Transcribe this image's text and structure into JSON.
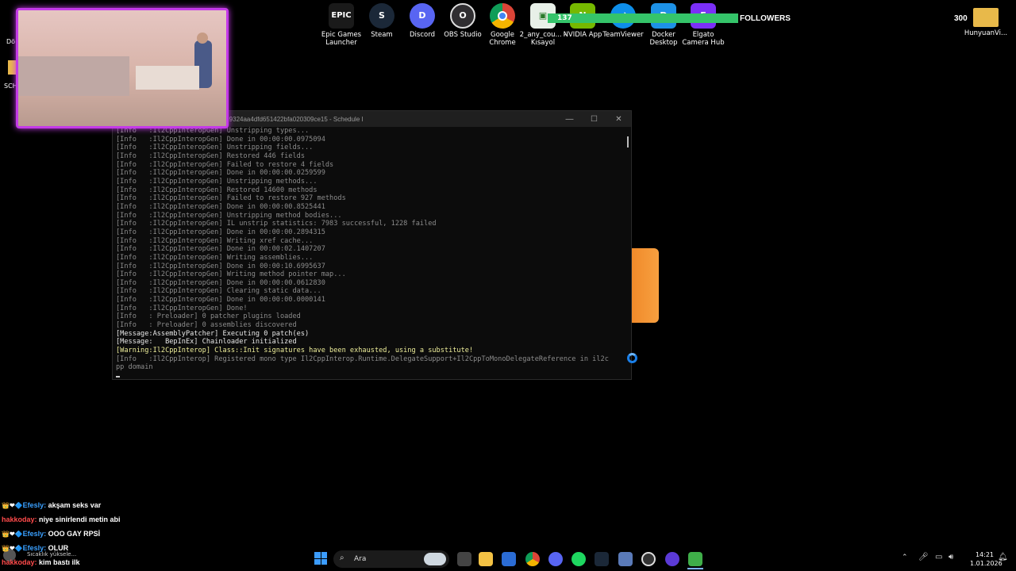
{
  "desktop_icons": [
    {
      "label": "Epic Games Launcher",
      "icon": "epic-games-icon",
      "color": "#1a1a1a",
      "glyph": "EPIC"
    },
    {
      "label": "Steam",
      "icon": "steam-icon",
      "color": "#1b2838",
      "glyph": "S"
    },
    {
      "label": "Discord",
      "icon": "discord-icon",
      "color": "#5865f2",
      "glyph": "D"
    },
    {
      "label": "OBS Studio",
      "icon": "obs-icon",
      "color": "#302e31",
      "glyph": "O"
    },
    {
      "label": "Google Chrome",
      "icon": "chrome-icon",
      "color": "#db4437",
      "glyph": "◉"
    },
    {
      "label": "2_any_cou... - Kısayol",
      "icon": "shortcut-icon",
      "color": "#e8f0e8",
      "glyph": "▣"
    },
    {
      "label": "NVIDIA App",
      "icon": "nvidia-icon",
      "color": "#76b900",
      "glyph": "N"
    },
    {
      "label": "TeamViewer",
      "icon": "teamviewer-icon",
      "color": "#0e8ee9",
      "glyph": "⇄"
    },
    {
      "label": "Docker Desktop",
      "icon": "docker-icon",
      "color": "#1d91e6",
      "glyph": "D"
    },
    {
      "label": "Elgato Camera Hub",
      "icon": "elgato-icon",
      "color": "#7b2ff7",
      "glyph": "E"
    },
    {
      "label": "HunyuanVi...",
      "icon": "folder-icon",
      "color": "#e8b94a",
      "glyph": ""
    }
  ],
  "left_icons": {
    "top_label": "Dö",
    "bottom_label": "SCH"
  },
  "followers": {
    "count": "137",
    "label": "FOLLOWERS",
    "goal": "300",
    "progress": 0.457
  },
  "console": {
    "title": "...9324aa4dfd651422bfa020309ce15 - Schedule I",
    "lines": [
      {
        "type": "info",
        "text": "[Info   :Il2CppInteropGen] Unstripping types..."
      },
      {
        "type": "info",
        "text": "[Info   :Il2CppInteropGen] Done in 00:00:00.0975094"
      },
      {
        "type": "info",
        "text": "[Info   :Il2CppInteropGen] Unstripping fields..."
      },
      {
        "type": "info",
        "text": "[Info   :Il2CppInteropGen] Restored 446 fields"
      },
      {
        "type": "info",
        "text": "[Info   :Il2CppInteropGen] Failed to restore 4 fields"
      },
      {
        "type": "info",
        "text": "[Info   :Il2CppInteropGen] Done in 00:00:00.0259599"
      },
      {
        "type": "info",
        "text": "[Info   :Il2CppInteropGen] Unstripping methods..."
      },
      {
        "type": "info",
        "text": "[Info   :Il2CppInteropGen] Restored 14600 methods"
      },
      {
        "type": "info",
        "text": "[Info   :Il2CppInteropGen] Failed to restore 927 methods"
      },
      {
        "type": "info",
        "text": "[Info   :Il2CppInteropGen] Done in 00:00:00.8525441"
      },
      {
        "type": "info",
        "text": "[Info   :Il2CppInteropGen] Unstripping method bodies..."
      },
      {
        "type": "info",
        "text": "[Info   :Il2CppInteropGen] IL unstrip statistics: 7983 successful, 1228 failed"
      },
      {
        "type": "info",
        "text": "[Info   :Il2CppInteropGen] Done in 00:00:00.2894315"
      },
      {
        "type": "info",
        "text": "[Info   :Il2CppInteropGen] Writing xref cache..."
      },
      {
        "type": "info",
        "text": "[Info   :Il2CppInteropGen] Done in 00:00:02.1407207"
      },
      {
        "type": "info",
        "text": "[Info   :Il2CppInteropGen] Writing assemblies..."
      },
      {
        "type": "info",
        "text": "[Info   :Il2CppInteropGen] Done in 00:00:10.6995637"
      },
      {
        "type": "info",
        "text": "[Info   :Il2CppInteropGen] Writing method pointer map..."
      },
      {
        "type": "info",
        "text": "[Info   :Il2CppInteropGen] Done in 00:00:00.0612830"
      },
      {
        "type": "info",
        "text": "[Info   :Il2CppInteropGen] Clearing static data..."
      },
      {
        "type": "info",
        "text": "[Info   :Il2CppInteropGen] Done in 00:00:00.0000141"
      },
      {
        "type": "info",
        "text": "[Info   :Il2CppInteropGen] Done!"
      },
      {
        "type": "info",
        "text": "[Info   : Preloader] 0 patcher plugins loaded"
      },
      {
        "type": "info",
        "text": "[Info   : Preloader] 0 assemblies discovered"
      },
      {
        "type": "msg",
        "text": "[Message:AssemblyPatcher] Executing 0 patch(es)"
      },
      {
        "type": "msg",
        "text": "[Message:   BepInEx] Chainloader initialized"
      },
      {
        "type": "warn",
        "text": "[Warning:Il2CppInterop] Class::Init signatures have been exhausted, using a substitute!"
      },
      {
        "type": "info",
        "text": "[Info   :Il2CppInterop] Registered mono type Il2CppInterop.Runtime.DelegateSupport+Il2CppToMonoDelegateReference in il2c"
      },
      {
        "type": "info",
        "text": "pp domain"
      }
    ]
  },
  "chat": [
    {
      "user": "Efesly:",
      "text": "akşam seks var",
      "user_color": "#3aa0ff",
      "badges": "👑 ❤ 🔷"
    },
    {
      "user": "hakkoday:",
      "text": "niye sinirlendi metin abi",
      "user_color": "#ff4b4b",
      "badges": ""
    },
    {
      "user": "Efesly:",
      "text": "OOO GAY RPSİ",
      "user_color": "#3aa0ff",
      "badges": "👑 ❤ 🔷"
    },
    {
      "user": "Efesly:",
      "text": "OLUR",
      "user_color": "#3aa0ff",
      "badges": "👑 ❤ 🔷"
    },
    {
      "user": "hakkoday:",
      "text": "kim bastı ilk",
      "user_color": "#ff4b4b",
      "badges": ""
    }
  ],
  "weather": {
    "text": "Sıcaklık yüksele..."
  },
  "taskbar": {
    "search_placeholder": "Ara",
    "apps": [
      "start-icon",
      "search-icon",
      "widgets-icon",
      "task-view-icon",
      "file-explorer-icon",
      "store-icon",
      "chrome-icon",
      "discord-icon",
      "spotify-icon",
      "steam-icon",
      "app-icon",
      "obs-icon",
      "browser-icon",
      "game-icon"
    ],
    "time": "14:21",
    "date": "1.01.2026"
  }
}
